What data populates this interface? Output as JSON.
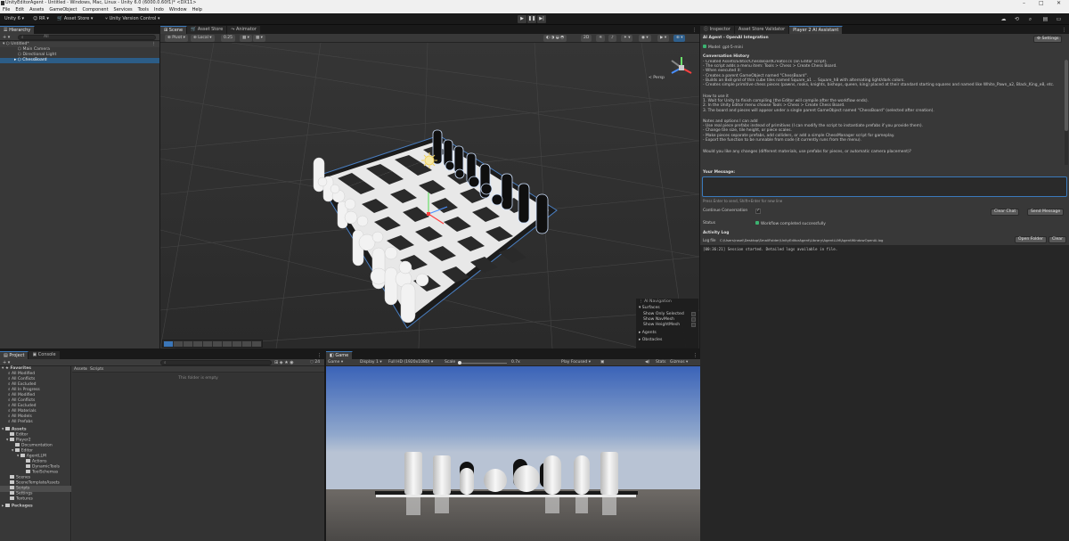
{
  "window": {
    "title": "UnityEditorAgent - Untitled - Windows, Mac, Linux - Unity 6.0 (6000.0.60f1)* <DX11>",
    "menu": [
      "File",
      "Edit",
      "Assets",
      "GameObject",
      "Component",
      "Services",
      "Tools",
      "Indo",
      "Window",
      "Help"
    ]
  },
  "toolbar": {
    "account": "Unity 6",
    "account_initials": "RR",
    "asset_store": "Asset Store",
    "version_control": "Unity Version Control"
  },
  "hierarchy": {
    "tab": "Hierarchy",
    "search_placeholder": "All",
    "scene_name": "Untitled*",
    "items": [
      "Main Camera",
      "Directional Light",
      "ChessBoard"
    ]
  },
  "scene": {
    "tabs": [
      "Scene",
      "Asset Store",
      "Animator"
    ],
    "pivot": "Pivot",
    "local": "Local",
    "snap_value": "0.25",
    "persp_label": "< Persp",
    "navigation": {
      "title": "AI Navigation",
      "surfaces": "Surfaces",
      "opts": [
        "Show Only Selected",
        "Show NavMesh",
        "Show HeightMesh"
      ],
      "agents": "Agents",
      "obstacles": "Obstacles"
    }
  },
  "inspector": {
    "tabs": [
      "Inspector",
      "Asset Store Validator",
      "Player 2 AI Assistant"
    ],
    "header": "AI Agent - OpenAI Integration",
    "settings_btn": "Settings",
    "model": "Model: gpt-5-mini",
    "conversation_title": "Conversation History",
    "history": [
      "- Created Assets/Editor/ChessBoardCreator.cs (an Editor script).",
      "- The script adds a menu item: Tools > Chess > Create Chess Board.",
      "- When executed it:",
      "  - Creates a parent GameObject named \"ChessBoard\".",
      "  - Builds an 8x8 grid of thin cube tiles named Square_a1 ... Square_h8 with alternating light/dark colors.",
      "  - Creates simple primitive chess pieces (pawns, rooks, knights, bishops, queen, king) placed at their standard starting squares and named like White_Pawn_a2, Black_King_e8, etc.",
      "",
      "How to use it",
      "1. Wait for Unity to finish compiling (the Editor will compile after the workflow ends).",
      "2. In the Unity Editor menu choose Tools > Chess > Create Chess Board.",
      "3. The board and pieces will appear under a single parent GameObject named \"ChessBoard\" (selected after creation).",
      "",
      "Notes and options I can add",
      "- Use real piece prefabs instead of primitives (I can modify the script to instantiate prefabs if you provide them).",
      "- Change tile size, tile height, or piece scales.",
      "- Make pieces separate prefabs, add colliders, or add a simple ChessManager script for gameplay.",
      "- Export the function to be runnable from code (it currently runs from the menu).",
      "",
      "Would you like any changes (different materials, use prefabs for pieces, or automatic camera placement)?"
    ],
    "your_message": "Your Message:",
    "hint": "Press Enter to send, Shift+Enter for new line",
    "continue_label": "Continue Conversation",
    "clear_chat": "Clear Chat",
    "send_message": "Send Message",
    "status_label": "Status",
    "status_value": "Workflow completed successfully",
    "activity_title": "Activity Log",
    "log_file_label": "Log file",
    "log_path": "C:\\Users\\rosel\\Desktop\\SmallFolder\\UnityEditorAgent\\Library\\AgentLLM\\AgentWindowOpenAi.log",
    "open_folder": "Open Folder",
    "clear": "Clear",
    "log_line": "[00:36:21] Session started. Detailed logs available in file."
  },
  "project": {
    "tabs": [
      "Project",
      "Console"
    ],
    "breadcrumb": [
      "Assets",
      "Scripts"
    ],
    "empty_text": "This folder is empty",
    "count": "24",
    "favorites_title": "Favorites",
    "favorites": [
      "All Modified",
      "All Conflicts",
      "All Excluded",
      "All In Progress",
      "All Modified",
      "All Conflicts",
      "All Excluded",
      "All Materials",
      "All Models",
      "All Prefabs"
    ],
    "assets_title": "Assets",
    "assets": [
      {
        "name": "Editor",
        "indent": 1
      },
      {
        "name": "Player2",
        "indent": 1
      },
      {
        "name": "Documentation",
        "indent": 2
      },
      {
        "name": "Editor",
        "indent": 2
      },
      {
        "name": "AgentLLM",
        "indent": 3
      },
      {
        "name": "Actions",
        "indent": 4
      },
      {
        "name": "DynamicTools",
        "indent": 4
      },
      {
        "name": "ToolSchemas",
        "indent": 4
      },
      {
        "name": "Scenes",
        "indent": 1
      },
      {
        "name": "SceneTemplateAssets",
        "indent": 1
      },
      {
        "name": "Scripts",
        "indent": 1
      },
      {
        "name": "Settings",
        "indent": 1
      },
      {
        "name": "Textures",
        "indent": 1
      }
    ],
    "packages": "Packages"
  },
  "game": {
    "tab": "Game",
    "mode": "Game",
    "display": "Display 1",
    "resolution": "Full HD (1920x1080)",
    "scale_label": "Scale",
    "scale_value": "0.7x",
    "play_focused": "Play Focused",
    "stats": "Stats",
    "gizmos": "Gizmos"
  }
}
